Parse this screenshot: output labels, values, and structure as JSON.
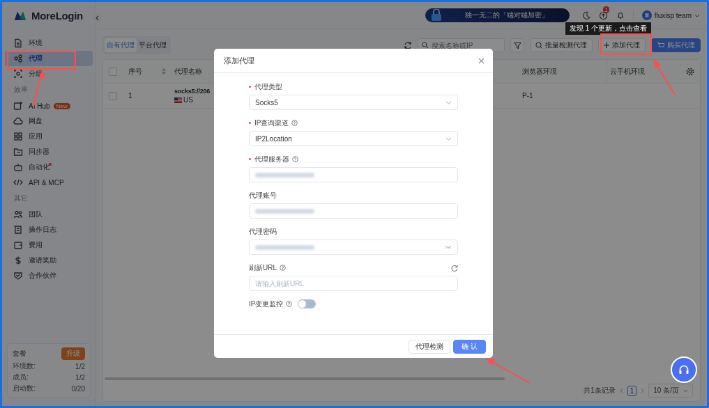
{
  "sidebar": {
    "logo": "MoreLogin",
    "sections": [
      {
        "items": [
          {
            "label": "环境",
            "selected": false
          },
          {
            "label": "代理",
            "selected": true
          },
          {
            "label": "分组",
            "selected": false
          }
        ]
      },
      {
        "title": "效率",
        "items": [
          {
            "label": "AI Hub",
            "selected": false,
            "badge": "New"
          },
          {
            "label": "网盘",
            "selected": false
          },
          {
            "label": "应用",
            "selected": false
          },
          {
            "label": "同步器",
            "selected": false
          },
          {
            "label": "自动化",
            "selected": false,
            "dot": true
          },
          {
            "label": "API & MCP",
            "selected": false
          }
        ]
      },
      {
        "title": "其它",
        "items": [
          {
            "label": "团队",
            "selected": false
          },
          {
            "label": "操作日志",
            "selected": false
          },
          {
            "label": "费用",
            "selected": false
          },
          {
            "label": "邀请奖励",
            "selected": false
          },
          {
            "label": "合作伙伴",
            "selected": false
          }
        ]
      }
    ],
    "plan": {
      "title": "套餐",
      "upgrade": "升级",
      "rows": [
        {
          "label": "环境数:",
          "value": "1/2"
        },
        {
          "label": "成员:",
          "value": "1/2"
        },
        {
          "label": "启动数:",
          "value": "0/20"
        }
      ]
    }
  },
  "header": {
    "banner": "独一无二的「端对端加密」",
    "update_badge": "1",
    "user": "fluxisp team",
    "tooltip": "发现 1 个更新，点击查看"
  },
  "tabs": [
    {
      "label": "自有代理",
      "selected": true
    },
    {
      "label": "平台代理",
      "selected": false
    }
  ],
  "toolbar": {
    "search": {
      "placeholder": "搜索名称或IP"
    },
    "buttons": [
      {
        "label": "批量检测代理",
        "kind": "check"
      },
      {
        "label": "添加代理",
        "kind": "add"
      },
      {
        "label": "购买代理",
        "kind": "buy"
      }
    ]
  },
  "table": {
    "select_all_checked": false,
    "columns": [
      "序号",
      "代理名称",
      "浏览器环境",
      "云手机环境"
    ],
    "rows": [
      {
        "checked": false,
        "index": "1",
        "name": "socks5://206",
        "country": "US",
        "browser_env": "P-1"
      }
    ]
  },
  "pagination": {
    "total": "共1条记录",
    "page": "1",
    "page_size": "10 条/页"
  },
  "dialog": {
    "title": "添加代理",
    "fields": [
      {
        "label": "代理类型",
        "required": true,
        "help": false,
        "kind": "select",
        "value": "Socks5"
      },
      {
        "label": "IP查询渠道",
        "required": true,
        "help": true,
        "kind": "select",
        "value": "IP2Location"
      },
      {
        "label": "代理服务器",
        "required": true,
        "help": true,
        "kind": "input",
        "redacted": true
      },
      {
        "label": "代理账号",
        "required": false,
        "help": false,
        "kind": "input",
        "redacted": true
      },
      {
        "label": "代理密码",
        "required": false,
        "help": false,
        "kind": "password",
        "redacted": true
      },
      {
        "label": "刷新URL",
        "required": false,
        "help": true,
        "kind": "input",
        "placeholder": "请输入刷新URL",
        "refresh": true
      },
      {
        "label": "IP变更监控",
        "required": false,
        "help": true,
        "kind": "toggle",
        "on": false
      }
    ],
    "buttons": [
      {
        "label": "代理检测",
        "kind": "secondary"
      },
      {
        "label": "确 认",
        "kind": "primary"
      }
    ]
  }
}
